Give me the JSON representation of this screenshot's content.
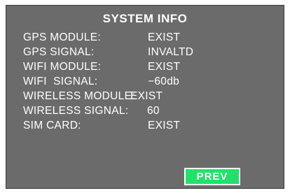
{
  "title": "SYSTEM INFO",
  "rows": [
    {
      "label": "GPS MODULE:",
      "value": "EXIST"
    },
    {
      "label": "GPS SIGNAL:",
      "value": "INVALTD"
    },
    {
      "label": "WIFI MODULE:",
      "value": "EXIST"
    },
    {
      "label": "WIFI  SIGNAL:",
      "value": "−60db"
    },
    {
      "label": "WIRELESS MODULE:",
      "value": "EXIST"
    },
    {
      "label": "WIRELESS SIGNAL:",
      "value": "60"
    },
    {
      "label": "SIM CARD:",
      "value": "EXIST"
    }
  ],
  "prev_label": "PREV",
  "colors": {
    "panel": "#6b6b6b",
    "text": "#ffffff",
    "button": "#22e06a"
  }
}
